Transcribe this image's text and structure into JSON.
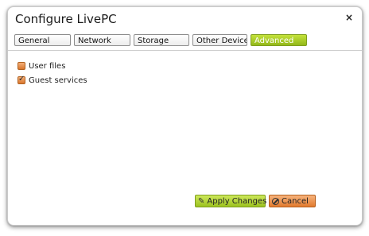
{
  "dialog": {
    "title": "Configure LivePC",
    "close_glyph": "×"
  },
  "tabs": [
    {
      "label": "General",
      "active": false
    },
    {
      "label": "Network",
      "active": false
    },
    {
      "label": "Storage",
      "active": false
    },
    {
      "label": "Other Devices",
      "active": false
    },
    {
      "label": "Advanced",
      "active": true
    }
  ],
  "options": [
    {
      "label": "User files",
      "checked": false
    },
    {
      "label": "Guest services",
      "checked": true
    }
  ],
  "buttons": {
    "apply_label": "Apply Changes",
    "apply_icon": "pencil-icon",
    "cancel_label": "Cancel",
    "cancel_icon": "prohibited-icon"
  },
  "colors": {
    "accent_green": "#9cc21f",
    "accent_orange": "#e27a2e"
  }
}
